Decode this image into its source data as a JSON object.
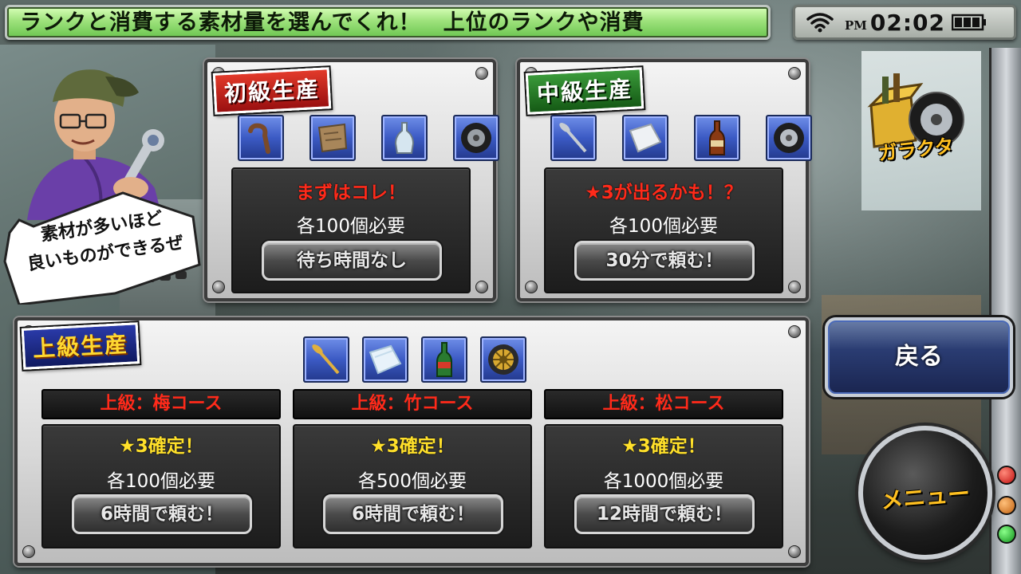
{
  "ticker": {
    "text": "ランクと消費する素材量を選んでくれ！　上位のランクや消費"
  },
  "status_bar": {
    "ampm": "PM",
    "time": "02:02"
  },
  "character": {
    "speech": [
      "素材が多いほど",
      "良いものができるぜ"
    ]
  },
  "panels": {
    "beginner": {
      "banner": "初級生産",
      "materials": [
        "bent-pipe-icon",
        "cloth-rag-icon",
        "glass-bottle-icon",
        "tire-icon"
      ],
      "tagline": "まずはコレ！",
      "requirement": "各100個必要",
      "button": "待ち時間なし"
    },
    "intermediate": {
      "banner": "中級生産",
      "materials": [
        "nail-icon",
        "white-cloth-icon",
        "brown-bottle-icon",
        "tire-icon"
      ],
      "tagline": "★3が出るかも！？",
      "requirement": "各100個必要",
      "button": "30分で頼む！"
    },
    "advanced": {
      "banner": "上級生産",
      "materials": [
        "gold-nail-icon",
        "silk-cloth-icon",
        "green-bottle-icon",
        "gold-wheel-icon"
      ],
      "courses": [
        {
          "name": "上級：梅コース",
          "tagline": "★3確定！",
          "requirement": "各100個必要",
          "button": "6時間で頼む！"
        },
        {
          "name": "上級：竹コース",
          "tagline": "★3確定！",
          "requirement": "各500個必要",
          "button": "6時間で頼む！"
        },
        {
          "name": "上級：松コース",
          "tagline": "★3確定！",
          "requirement": "各1000個必要",
          "button": "12時間で頼む！"
        }
      ]
    }
  },
  "side": {
    "junk_label": "ガラクタ",
    "back_button": "戻る",
    "menu_button": "メニュー"
  },
  "colors": {
    "ticker_green": "#8fdc6e",
    "tagline_red": "#ff2a1a",
    "star_yellow": "#ffe02a",
    "menu_orange": "#ffc020",
    "lamp_red": "#e02020",
    "lamp_orange": "#e07a10",
    "lamp_green": "#20b030"
  }
}
